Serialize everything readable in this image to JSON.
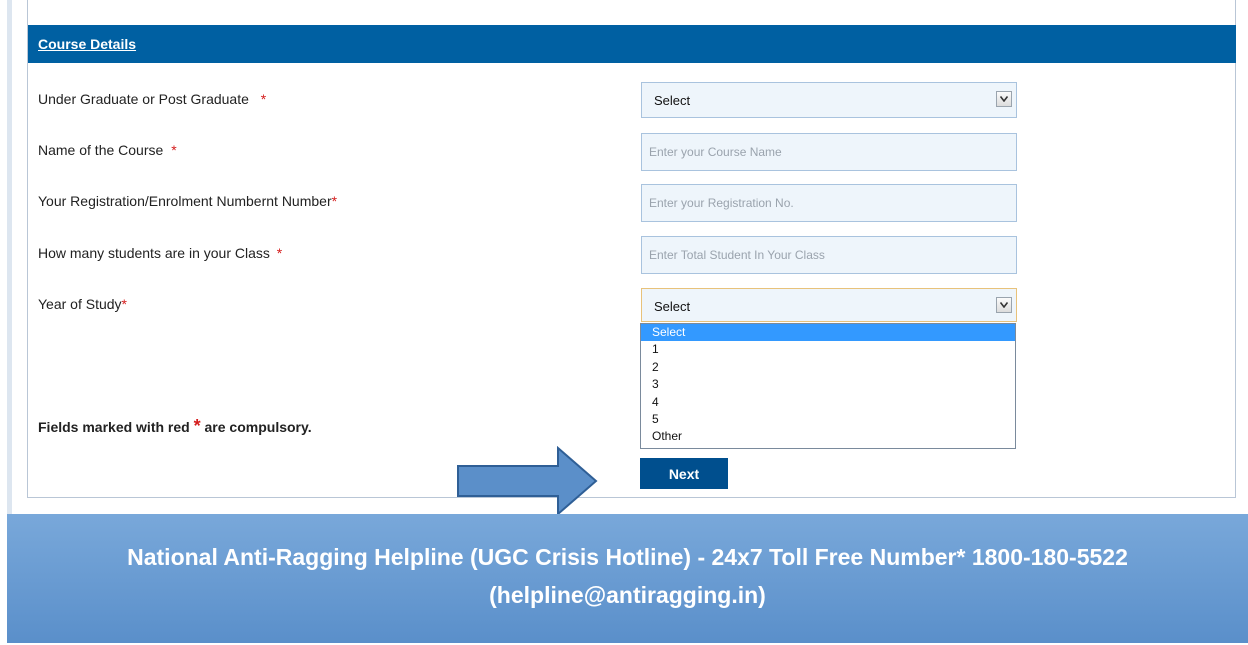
{
  "section": {
    "title": "Course Details"
  },
  "form": {
    "required_mark": "*",
    "rows": [
      {
        "label": "Under Graduate or Post Graduate",
        "type": "select",
        "value": "Select"
      },
      {
        "label": "Name of the Course",
        "type": "text",
        "placeholder": "Enter your Course Name"
      },
      {
        "label": "Your Registration/Enrolment Numbernt Number",
        "type": "text",
        "placeholder": "Enter your Registration No."
      },
      {
        "label": "How many students are in your Class",
        "type": "text",
        "placeholder": "Enter Total Student In Your Class"
      },
      {
        "label": "Year of Study",
        "type": "select",
        "value": "Select"
      }
    ],
    "year_options": [
      "Select",
      "1",
      "2",
      "3",
      "4",
      "5",
      "Other"
    ],
    "note_before": "Fields marked with red",
    "note_after": "are compulsory.",
    "next_label": "Next"
  },
  "footer": {
    "line1": "National Anti-Ragging Helpline (UGC Crisis Hotline) - 24x7 Toll Free Number* 1800-180-5522",
    "line2": "(helpline@antiragging.in)"
  },
  "colors": {
    "header_bg": "#0060a2",
    "button_bg": "#004f8e",
    "required": "#d41c1c",
    "footer_bg": "#6a9dd3",
    "dropdown_highlight": "#3399ff"
  }
}
